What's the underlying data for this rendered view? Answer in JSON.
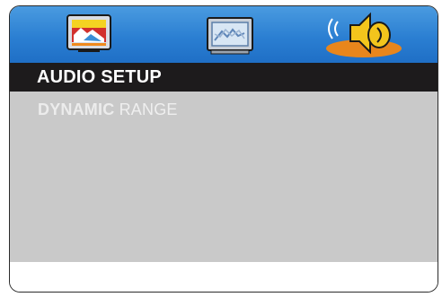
{
  "title": "AUDIO SETUP",
  "menu": {
    "item_word1": "DYNAMIC",
    "item_word2": "RANGE"
  },
  "tabs": [
    {
      "name": "general-setup",
      "icon": "tv-picture-icon"
    },
    {
      "name": "video-setup",
      "icon": "monitor-icon"
    },
    {
      "name": "audio-setup",
      "icon": "speaker-icon",
      "selected": true
    }
  ],
  "colors": {
    "tabbar": "#2b7fd2",
    "titlebar": "#1d1b1c",
    "content": "#c9c9c9",
    "selected_highlight": "#e8861c"
  }
}
